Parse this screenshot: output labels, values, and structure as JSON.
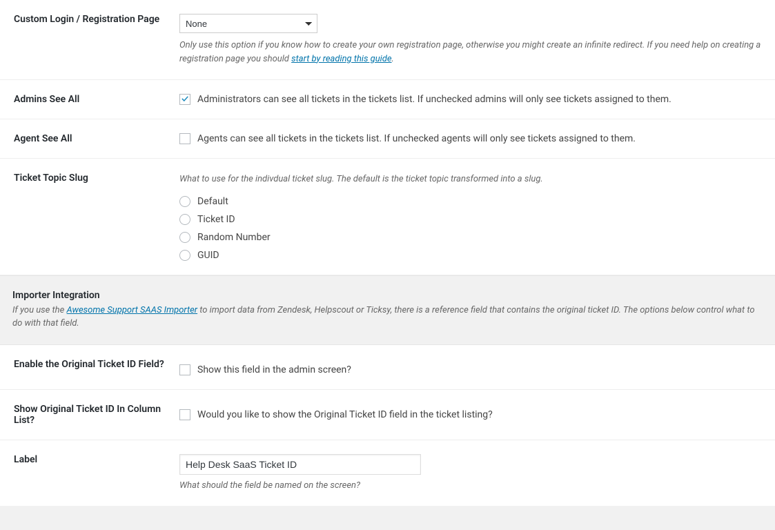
{
  "customLogin": {
    "label": "Custom Login / Registration Page",
    "selected": "None",
    "desc_before": "Only use this option if you know how to create your own registration page, otherwise you might create an infinite redirect. If you need help on creating a registration page you should ",
    "link_text": "start by reading this guide",
    "desc_after": "."
  },
  "adminsSeeAll": {
    "label": "Admins See All",
    "checked": true,
    "text": "Administrators can see all tickets in the tickets list. If unchecked admins will only see tickets assigned to them."
  },
  "agentSeeAll": {
    "label": "Agent See All",
    "checked": false,
    "text": "Agents can see all tickets in the tickets list. If unchecked agents will only see tickets assigned to them."
  },
  "ticketSlug": {
    "label": "Ticket Topic Slug",
    "desc": "What to use for the indivdual ticket slug. The default is the ticket topic transformed into a slug.",
    "options": [
      {
        "label": "Default",
        "checked": false
      },
      {
        "label": "Ticket ID",
        "checked": false
      },
      {
        "label": "Random Number",
        "checked": false
      },
      {
        "label": "GUID",
        "checked": false
      }
    ]
  },
  "importer": {
    "title": "Importer Integration",
    "desc_before": "If you use the ",
    "link_text": "Awesome Support SAAS Importer",
    "desc_after": " to import data from Zendesk, Helpscout or Ticksy, there is a reference field that contains the original ticket ID. The options below control what to do with that field."
  },
  "enableOriginal": {
    "label": "Enable the Original Ticket ID Field?",
    "checked": false,
    "text": "Show this field in the admin screen?"
  },
  "showOriginal": {
    "label": "Show Original Ticket ID In Column List?",
    "checked": false,
    "text": "Would you like to show the Original Ticket ID field in the ticket listing?"
  },
  "labelField": {
    "label": "Label",
    "value": "Help Desk SaaS Ticket ID",
    "desc": "What should the field be named on the screen?"
  }
}
